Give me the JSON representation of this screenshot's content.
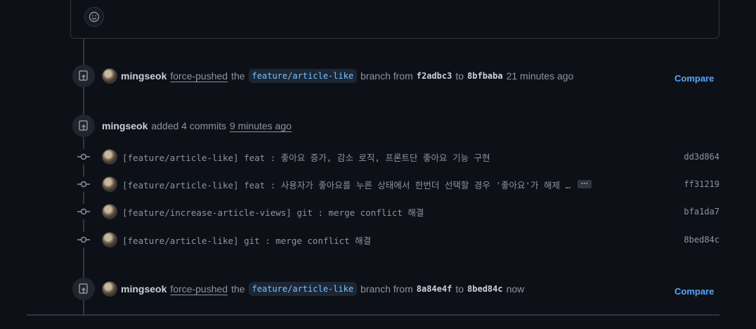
{
  "events": [
    {
      "author": "mingseok",
      "action": "force-pushed",
      "the": "the",
      "branch": "feature/article-like",
      "branch_from": "branch from",
      "from_sha": "f2adbc3",
      "to_word": "to",
      "to_sha": "8bfbaba",
      "time": "21 minutes ago",
      "compare": "Compare"
    },
    {
      "author": "mingseok",
      "action": "added 4 commits",
      "time": "9 minutes ago"
    },
    {
      "author": "mingseok",
      "action": "force-pushed",
      "the": "the",
      "branch": "feature/article-like",
      "branch_from": "branch from",
      "from_sha": "8a84e4f",
      "to_word": "to",
      "to_sha": "8bed84c",
      "time": "now",
      "compare": "Compare"
    }
  ],
  "commits": [
    {
      "message": "[feature/article-like] feat : 좋아요 증가, 감소 로직, 프론트단 좋아요 기능 구현",
      "sha": "dd3d864"
    },
    {
      "message": "[feature/article-like] feat : 사용자가 좋아요를 누른 상태에서 한번더 선택할 경우 '좋아요'가 해제 …",
      "sha": "ff31219",
      "more": "···"
    },
    {
      "message": "[feature/increase-article-views] git : merge conflict 해결",
      "sha": "bfa1da7"
    },
    {
      "message": "[feature/article-like] git : merge conflict 해결",
      "sha": "8bed84c"
    }
  ],
  "icons": {
    "emoji": "smiley-icon",
    "push": "repo-push-icon",
    "commit": "git-commit-icon"
  },
  "colors": {
    "background": "#0d1117",
    "link": "#58a6ff",
    "branch": "#79c0ff"
  }
}
